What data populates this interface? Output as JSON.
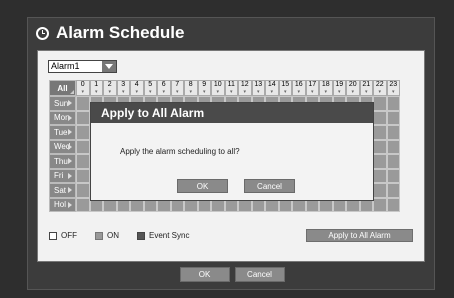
{
  "window": {
    "title": "Alarm Schedule",
    "title_icon": "clock-icon"
  },
  "alarm_select": {
    "value": "Alarm1",
    "icon": "chevron-down-icon"
  },
  "schedule": {
    "all_label": "All",
    "hours": [
      "0",
      "1",
      "2",
      "3",
      "4",
      "5",
      "6",
      "7",
      "8",
      "9",
      "10",
      "11",
      "12",
      "13",
      "14",
      "15",
      "16",
      "17",
      "18",
      "19",
      "20",
      "21",
      "22",
      "23"
    ],
    "days": [
      "Sun",
      "Mon",
      "Tue",
      "Wed",
      "Thu",
      "Fri",
      "Sat",
      "Hol"
    ]
  },
  "legend": {
    "off": "OFF",
    "on": "ON",
    "event_sync": "Event Sync"
  },
  "apply_all_button": "Apply to All Alarm",
  "footer": {
    "ok": "OK",
    "cancel": "Cancel"
  },
  "dialog": {
    "title": "Apply to All Alarm",
    "message": "Apply the alarm scheduling to all?",
    "ok": "OK",
    "cancel": "Cancel"
  },
  "colors": {
    "cell_on": "#9a9a9a",
    "header_bg": "#888888",
    "dialog_title_bg": "#4a4a4a"
  }
}
